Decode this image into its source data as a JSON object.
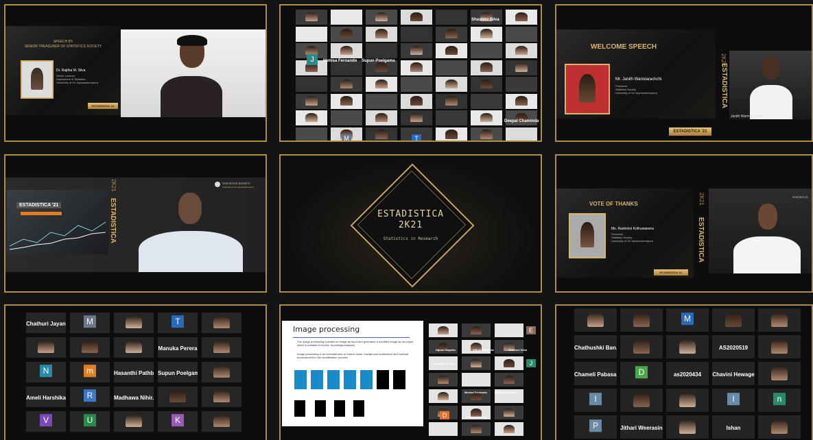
{
  "colors": {
    "border": "#b08d4a",
    "gold": "#d9b56a",
    "bg": "#141414"
  },
  "p1": {
    "slide_title_line1": "SPEECH BY",
    "slide_title_line2": "SENIOR TREASURER OF STATISTICS SOCIETY",
    "speaker_name": "Dr. Rajitha M. Silva",
    "speaker_role1": "Senior Lecturer",
    "speaker_role2": "Department of Statistics",
    "speaker_role3": "University of Sri Jayewardenepura",
    "badge": "ESTADISTICA '21",
    "cam_label": "Rajitha M. Silva"
  },
  "p2": {
    "tiles": [
      "Shashini Silva",
      "Menisa Fernando",
      "Supun Poelgama",
      "Deepal Chaminda",
      "J",
      "M",
      "T"
    ]
  },
  "p3": {
    "title": "WELCOME SPEECH",
    "speaker_name": "Mr. Janith Wanniarachchi",
    "role1": "President",
    "role2": "Statistics Society",
    "role3": "University of Sri Jayewardenepura",
    "badge": "ESTADISTICA '21",
    "vertical": "ESTADISTICA",
    "year": "2K21",
    "cam_label": "Janith Wanniarachchi"
  },
  "p4": {
    "logo_text": "STATISTICS SOCIETY",
    "logo_sub": "University of Sri Jayewardenepura",
    "slide_small": "ESTADISTICA '21",
    "vertical": "ESTADISTICA",
    "year": "2K21"
  },
  "p5": {
    "title": "ESTADISTICA",
    "year": "2K21",
    "subtitle": "Statistics in Research"
  },
  "p6": {
    "title": "VOTE OF THANKS",
    "speaker_name": "Ms. Rashmini Kothuwawera",
    "role1": "Secretary",
    "role2": "Statistics Society",
    "role3": "University of Sri Jayewardenepura",
    "badge": "ESTADISTICA '21",
    "vertical": "ESTADISTICA",
    "year": "2K21",
    "logo_text": "STATISTICS"
  },
  "p7": {
    "tiles": [
      {
        "name": "Chathuri Jayani...",
        "letter": ""
      },
      {
        "name": "",
        "letter": "M"
      },
      {
        "name": "",
        "letter": ""
      },
      {
        "name": "",
        "letter": "T"
      },
      {
        "name": "",
        "letter": ""
      },
      {
        "name": "",
        "letter": ""
      },
      {
        "name": "",
        "letter": ""
      },
      {
        "name": "",
        "letter": ""
      },
      {
        "name": "Manuka Perera",
        "letter": ""
      },
      {
        "name": "",
        "letter": ""
      },
      {
        "name": "",
        "letter": "N"
      },
      {
        "name": "",
        "letter": "m"
      },
      {
        "name": "Hasanthi Pathb...",
        "letter": ""
      },
      {
        "name": "Supun Poelgama",
        "letter": ""
      },
      {
        "name": "",
        "letter": ""
      },
      {
        "name": "Ameli Harshika",
        "letter": ""
      },
      {
        "name": "",
        "letter": "R"
      },
      {
        "name": "Madhawa Nihir...",
        "letter": ""
      },
      {
        "name": "",
        "letter": ""
      },
      {
        "name": "",
        "letter": ""
      },
      {
        "name": "",
        "letter": "V"
      },
      {
        "name": "",
        "letter": "U"
      },
      {
        "name": "",
        "letter": ""
      },
      {
        "name": "",
        "letter": "K"
      },
      {
        "name": "",
        "letter": ""
      }
    ]
  },
  "p8": {
    "slide_title": "Image processing",
    "bullet1": "The image processing includes an image as input and generates a modified image as an output which is suitable for further recordings/analyses",
    "bullet2": "Image processing is an essential step to reduce noise, background subtraction and contrast enhancement in the identification process",
    "tiles": [
      "Nipuni Gayathe",
      "Sithmi Senthinie",
      "Shashini Silva",
      "Nimanthi Ranay...",
      "Menisa Fernando",
      "Uditha Kuriyadan...",
      "Sachithi Geenan",
      "D",
      "J",
      "E"
    ]
  },
  "p9": {
    "tiles": [
      {
        "name": "",
        "letter": ""
      },
      {
        "name": "",
        "letter": ""
      },
      {
        "name": "",
        "letter": "M"
      },
      {
        "name": "",
        "letter": ""
      },
      {
        "name": "",
        "letter": ""
      },
      {
        "name": "Chathushki Ban...",
        "letter": ""
      },
      {
        "name": "",
        "letter": ""
      },
      {
        "name": "",
        "letter": ""
      },
      {
        "name": "AS2020519",
        "letter": ""
      },
      {
        "name": "",
        "letter": ""
      },
      {
        "name": "Chameli Pabasara",
        "letter": ""
      },
      {
        "name": "",
        "letter": "D"
      },
      {
        "name": "as2020434",
        "letter": ""
      },
      {
        "name": "Chavini Hewage",
        "letter": ""
      },
      {
        "name": "",
        "letter": ""
      },
      {
        "name": "",
        "letter": "I"
      },
      {
        "name": "",
        "letter": ""
      },
      {
        "name": "",
        "letter": ""
      },
      {
        "name": "",
        "letter": "I"
      },
      {
        "name": "",
        "letter": "n"
      },
      {
        "name": "",
        "letter": "P"
      },
      {
        "name": "Jithari Weerasin...",
        "letter": ""
      },
      {
        "name": "",
        "letter": ""
      },
      {
        "name": "Ishan",
        "letter": ""
      },
      {
        "name": "",
        "letter": ""
      }
    ]
  }
}
